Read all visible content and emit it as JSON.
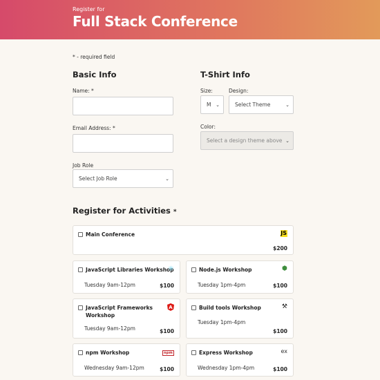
{
  "header": {
    "subtitle": "Register for",
    "title": "Full Stack Conference"
  },
  "required_note": "* - required field",
  "basic_info": {
    "heading": "Basic Info",
    "name_label": "Name: *",
    "email_label": "Email Address: *",
    "job_role_label": "Job Role",
    "job_role_value": "Select Job Role"
  },
  "tshirt": {
    "heading": "T-Shirt Info",
    "size_label": "Size:",
    "size_value": "M",
    "design_label": "Design:",
    "design_value": "Select Theme",
    "color_label": "Color:",
    "color_value": "Select a design theme above"
  },
  "activities": {
    "heading": "Register for Activities",
    "required_mark": "*",
    "items": [
      {
        "name": "Main Conference",
        "when": "",
        "price": "$200",
        "icon": "js-icon",
        "icon_text": "JS"
      },
      {
        "name": "JavaScript Libraries Workshop",
        "when": "Tuesday 9am-12pm",
        "price": "$100",
        "icon": "react-icon",
        "icon_text": "⚛"
      },
      {
        "name": "Node.js Workshop",
        "when": "Tuesday 1pm-4pm",
        "price": "$100",
        "icon": "nodejs-icon",
        "icon_text": "⬢"
      },
      {
        "name": "JavaScript Frameworks Workshop",
        "when": "Tuesday 9am-12pm",
        "price": "$100",
        "icon": "angular-icon",
        "icon_text": "A"
      },
      {
        "name": "Build tools Workshop",
        "when": "Tuesday 1pm-4pm",
        "price": "$100",
        "icon": "tools-icon",
        "icon_text": "⚒"
      },
      {
        "name": "npm Workshop",
        "when": "Wednesday 9am-12pm",
        "price": "$100",
        "icon": "npm-icon",
        "icon_text": "npm"
      },
      {
        "name": "Express Workshop",
        "when": "Wednesday 1pm-4pm",
        "price": "$100",
        "icon": "express-icon",
        "icon_text": "ex"
      }
    ]
  }
}
